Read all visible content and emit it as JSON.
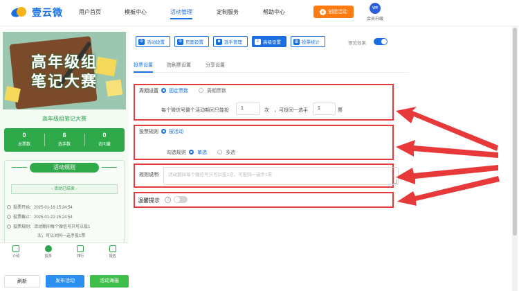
{
  "header": {
    "logo_text": "壹云微",
    "nav": [
      {
        "label": "用户首页",
        "active": false
      },
      {
        "label": "模板中心",
        "active": false
      },
      {
        "label": "活动管理",
        "active": true
      },
      {
        "label": "定制服务",
        "active": false
      },
      {
        "label": "帮助中心",
        "active": false
      }
    ],
    "create_button": "创建活动",
    "vip_badge": "VIP",
    "vip_label": "会员升级"
  },
  "preview": {
    "banner_line1": "高年级组",
    "banner_line2": "笔记大赛",
    "activity_name": "高年级组笔记大赛",
    "stats": [
      {
        "value": "0",
        "label": "总票数"
      },
      {
        "value": "6",
        "label": "选手数"
      },
      {
        "value": "0",
        "label": "访问量"
      }
    ],
    "rules_title": "活动规则",
    "status": "- 活动已结束 -",
    "vote_start": "投票开始：2025-01-16 15:24:54",
    "vote_end": "投票截止：2025-01-22 15:24:54",
    "vote_rule": "投票规则：活动期间每个微信号只可以投1",
    "vote_rule_cont": "次，可以对同一选手投1票",
    "tabs": [
      {
        "label": "介绍",
        "active": false
      },
      {
        "label": "投票",
        "active": true
      },
      {
        "label": "排行",
        "active": false
      },
      {
        "label": "报名",
        "active": false
      }
    ]
  },
  "bottom_buttons": {
    "refresh": "刷新",
    "publish": "发布活动",
    "poster": "活动海报"
  },
  "toolbar": {
    "tools": [
      {
        "label": "活动设置",
        "icon": "gear-icon",
        "active": false
      },
      {
        "label": "页面设置",
        "icon": "gear-icon",
        "active": false
      },
      {
        "label": "选手管理",
        "icon": "users-icon",
        "active": false
      },
      {
        "label": "高级设置",
        "icon": "sliders-icon",
        "active": true
      },
      {
        "label": "投票统计",
        "icon": "bar-chart-icon",
        "active": false
      }
    ],
    "preview_label": "预览效果",
    "preview_on": true
  },
  "subtabs": [
    {
      "label": "投票设置",
      "active": true
    },
    {
      "label": "防刷票设置",
      "active": false
    },
    {
      "label": "分享设置",
      "active": false
    }
  ],
  "form": {
    "period_label": "周期设置",
    "period_options": [
      {
        "label": "固定票数",
        "selected": true
      },
      {
        "label": "周期票数",
        "selected": false
      }
    ],
    "per_wechat_text": "每个微信号整个活动期间只能投",
    "votes_total": "1",
    "times_unit": "次",
    "same_player_text": "，可投同一选手",
    "votes_same": "1",
    "ticket_unit": "票",
    "rule_label": "投票规则",
    "rule_option": "按活动",
    "check_label": "勾选规则",
    "check_options": [
      {
        "label": "单选",
        "selected": true
      },
      {
        "label": "多选",
        "selected": false
      }
    ],
    "desc_label": "规则说明",
    "desc_placeholder": "活动期间每个微信号只可以投1次，可投同一选手1票",
    "tip_label": "温馨提示",
    "tip_on": false
  },
  "colors": {
    "brand_blue": "#1a6fe0",
    "highlight_red": "#e8393a",
    "preview_green": "#2eaa4a",
    "create_orange": "#ff7a10"
  }
}
